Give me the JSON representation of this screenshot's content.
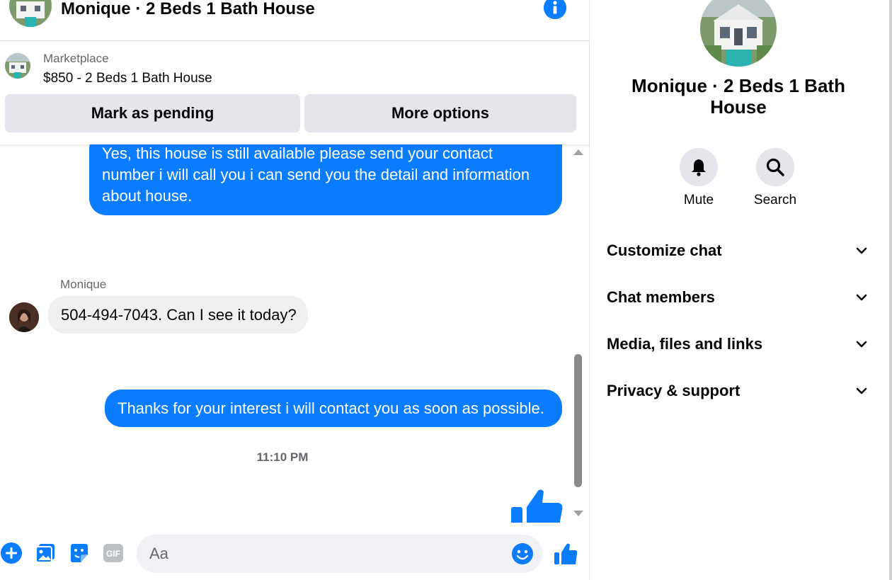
{
  "colors": {
    "accent": "#0a7cff",
    "bubble_in": "#f0f0f0",
    "button_bg": "#e4e6eb",
    "secondary_text": "#65676b"
  },
  "header": {
    "title": "Monique · 2 Beds 1 Bath House",
    "info_icon": "info-icon"
  },
  "listing": {
    "source": "Marketplace",
    "price_title": "$850 - 2 Beds 1 Bath House",
    "mark_pending_label": "Mark as pending",
    "more_options_label": "More options"
  },
  "messages": [
    {
      "direction": "outgoing",
      "text": "Yes, this house is still available please send your contact number i will call you i can send you the detail and information about house."
    },
    {
      "direction": "incoming",
      "sender": "Monique",
      "text": "504-494-7043. Can I see it today?"
    },
    {
      "direction": "outgoing",
      "text": "Thanks for your interest i will contact you as soon as possible."
    },
    {
      "direction": "outgoing",
      "type": "like-sticker"
    }
  ],
  "timestamp": "11:10 PM",
  "composer": {
    "placeholder": "Aa",
    "icons": [
      "plus-icon",
      "photo-icon",
      "sticker-icon",
      "gif-icon",
      "emoji-icon",
      "thumbs-up-icon"
    ],
    "gif_label": "GIF"
  },
  "info_panel": {
    "name": "Monique · 2 Beds 1 Bath House",
    "actions": [
      {
        "label": "Mute",
        "icon": "bell-icon"
      },
      {
        "label": "Search",
        "icon": "search-icon"
      }
    ],
    "sections": [
      {
        "label": "Customize chat"
      },
      {
        "label": "Chat members"
      },
      {
        "label": "Media, files and links"
      },
      {
        "label": "Privacy & support"
      }
    ]
  }
}
